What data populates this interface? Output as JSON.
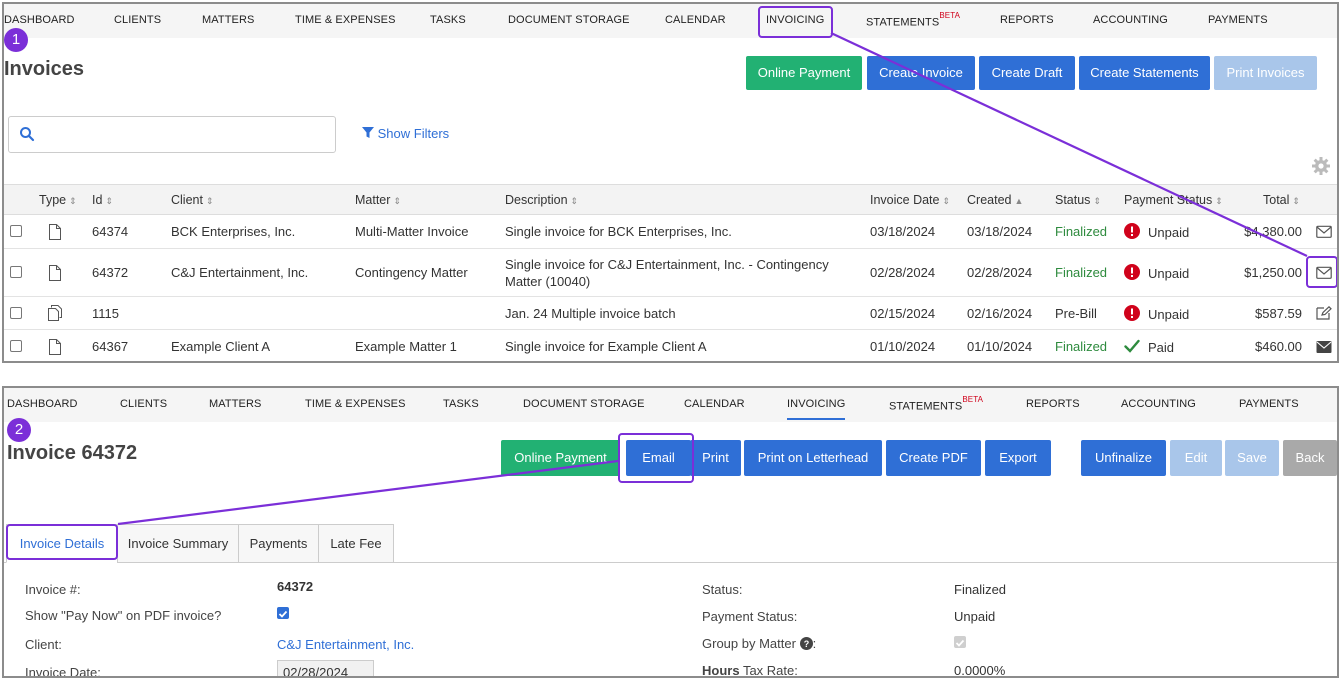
{
  "nav": {
    "items": [
      "DASHBOARD",
      "CLIENTS",
      "MATTERS",
      "TIME & EXPENSES",
      "TASKS",
      "DOCUMENT STORAGE",
      "CALENDAR",
      "INVOICING",
      "STATEMENTS",
      "REPORTS",
      "ACCOUNTING",
      "PAYMENTS"
    ],
    "beta": "BETA",
    "active": "INVOICING"
  },
  "steps": {
    "one": "1",
    "two": "2"
  },
  "invoices_page": {
    "title": "Invoices",
    "buttons": {
      "online_payment": "Online Payment",
      "create_invoice": "Create Invoice",
      "create_draft": "Create Draft",
      "create_statements": "Create Statements",
      "print_invoices": "Print Invoices"
    },
    "search": {
      "value": "",
      "placeholder": ""
    },
    "show_filters": "Show Filters",
    "columns": [
      "Type",
      "Id",
      "Client",
      "Matter",
      "Description",
      "Invoice Date",
      "Created",
      "Status",
      "Payment Status",
      "Total"
    ],
    "rows": [
      {
        "id": "64374",
        "client": "BCK Enterprises, Inc.",
        "matter": "Multi-Matter Invoice",
        "description": "Single invoice for BCK Enterprises, Inc.",
        "invoice_date": "03/18/2024",
        "created": "03/18/2024",
        "status": "Finalized",
        "payment_status": "Unpaid",
        "total": "$4,380.00",
        "type_icon": "document-icon",
        "action_icon": "envelope-outline-icon"
      },
      {
        "id": "64372",
        "client": "C&J Entertainment, Inc.",
        "matter": "Contingency Matter",
        "description": "Single invoice for C&J Entertainment, Inc. - Contingency Matter (10040)",
        "invoice_date": "02/28/2024",
        "created": "02/28/2024",
        "status": "Finalized",
        "payment_status": "Unpaid",
        "total": "$1,250.00",
        "type_icon": "document-icon",
        "action_icon": "envelope-outline-icon"
      },
      {
        "id": "1115",
        "client": "",
        "matter": "",
        "description": "Jan. 24 Multiple invoice batch",
        "invoice_date": "02/15/2024",
        "created": "02/16/2024",
        "status": "Pre-Bill",
        "payment_status": "Unpaid",
        "total": "$587.59",
        "type_icon": "multiple-documents-icon",
        "action_icon": "edit-icon"
      },
      {
        "id": "64367",
        "client": "Example Client A",
        "matter": "Example Matter 1",
        "description": "Single invoice for Example Client A",
        "invoice_date": "01/10/2024",
        "created": "01/10/2024",
        "status": "Finalized",
        "payment_status": "Paid",
        "total": "$460.00",
        "type_icon": "document-icon",
        "action_icon": "envelope-filled-icon"
      }
    ]
  },
  "invoice_page": {
    "title": "Invoice 64372",
    "buttons": {
      "online_payment": "Online Payment",
      "email": "Email",
      "print": "Print",
      "print_letterhead": "Print on Letterhead",
      "create_pdf": "Create PDF",
      "export": "Export",
      "unfinalize": "Unfinalize",
      "edit": "Edit",
      "save": "Save",
      "back": "Back"
    },
    "tabs": [
      "Invoice Details",
      "Invoice Summary",
      "Payments",
      "Late Fee"
    ],
    "details": {
      "invoice_num_label": "Invoice #:",
      "invoice_num": "64372",
      "pay_now_label": "Show \"Pay Now\" on PDF invoice?",
      "client_label": "Client:",
      "client": "C&J Entertainment, Inc.",
      "invoice_date_label": "Invoice Date:",
      "invoice_date": "02/28/2024",
      "status_label": "Status:",
      "status": "Finalized",
      "payment_status_label": "Payment Status:",
      "payment_status": "Unpaid",
      "group_by_label": "Group by Matter",
      "hours_bold": "Hours",
      "tax_rate_label": " Tax Rate:",
      "tax_rate": "0.0000%"
    }
  },
  "colors": {
    "accent": "#2f6fd6",
    "success": "#22b173",
    "highlight": "#7b2fd8",
    "danger": "#d0021b"
  }
}
